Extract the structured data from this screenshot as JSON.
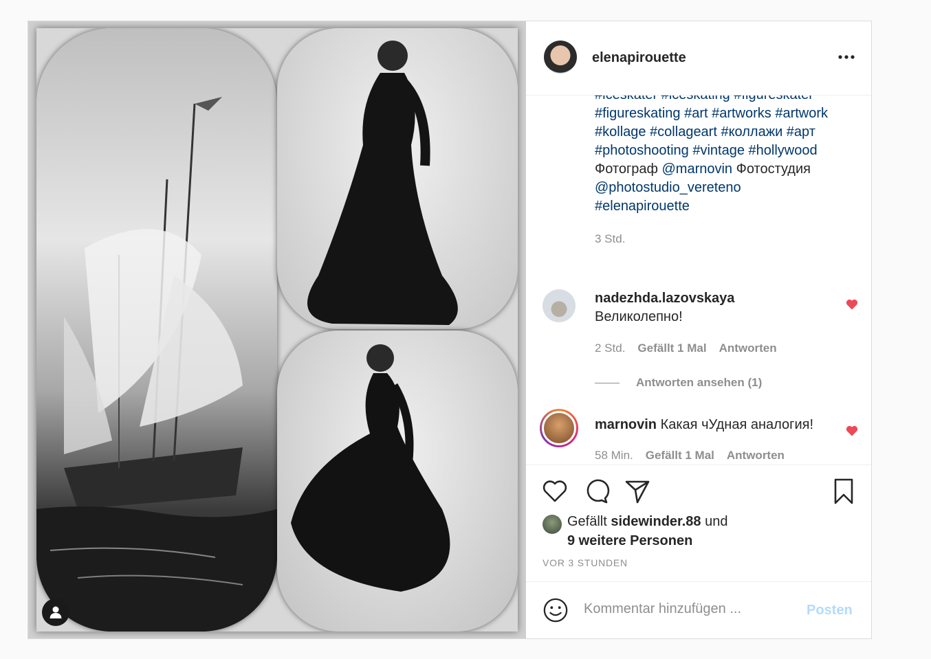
{
  "post": {
    "owner": "elenapirouette",
    "more_icon": "more-horizontal-icon",
    "caption_lines": {
      "l0": "#iceskater #iceskating #figureskater",
      "l1": "#figureskating #art #artworks #artwork",
      "l2": "#kollage #collageart #коллажи #арт",
      "l3": "#photoshooting #vintage #hollywood",
      "l4_a": "Фотограф ",
      "l4_b": "@marnovin",
      "l4_c": " Фотостудия",
      "l5": "@photostudio_vereteno",
      "l6": "#elenapirouette"
    },
    "caption_time": "3 Std."
  },
  "comments": [
    {
      "user": "nadezhda.lazovskaya",
      "text": "Великолепно!",
      "time": "2 Std.",
      "likes": "Gefällt 1 Mal",
      "reply": "Antworten",
      "view_replies": "Antworten ansehen (1)"
    },
    {
      "user": "marnovin",
      "text": "Какая чУдная аналогия!",
      "time": "58 Min.",
      "likes": "Gefällt 1 Mal",
      "reply": "Antworten"
    }
  ],
  "likes": {
    "prefix": "Gefällt ",
    "user": "sidewinder.88",
    "mid": " und",
    "others": "9 weitere Personen"
  },
  "timestamp": "VOR 3 STUNDEN",
  "add_comment": {
    "placeholder": "Kommentar hinzufügen ...",
    "post_label": "Posten"
  },
  "colors": {
    "hashtag": "#00376b",
    "heart": "#ed4956",
    "post_disabled": "#b3dbff"
  }
}
